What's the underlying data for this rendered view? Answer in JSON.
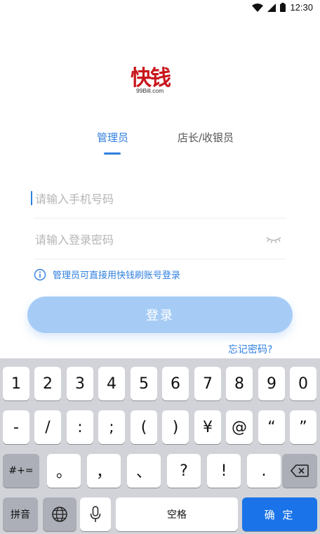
{
  "status": {
    "time": "12:30"
  },
  "logo": {
    "brand": "快钱",
    "sub": "99Bill.com"
  },
  "tabs": [
    {
      "label": "管理员",
      "active": true
    },
    {
      "label": "店长/收银员",
      "active": false
    }
  ],
  "form": {
    "phone_placeholder": "请输入手机号码",
    "password_placeholder": "请输入登录密码",
    "tip": "管理员可直接用快钱刷账号登录",
    "login_label": "登录",
    "forgot_label": "忘记密码?"
  },
  "keyboard": {
    "row1": [
      "1",
      "2",
      "3",
      "4",
      "5",
      "6",
      "7",
      "8",
      "9",
      "0"
    ],
    "row2": [
      "-",
      "/",
      ":",
      ";",
      "(",
      ")",
      "¥",
      "@",
      "“",
      "”"
    ],
    "row3": [
      "#+=",
      "。",
      "，",
      "、",
      "?",
      "!",
      "."
    ],
    "pinyin": "拼音",
    "space": "空格",
    "confirm": "确 定"
  },
  "colors": {
    "accent": "#2f7fe0",
    "brand": "#c8161d",
    "button_disabled": "#a6ccf6"
  }
}
